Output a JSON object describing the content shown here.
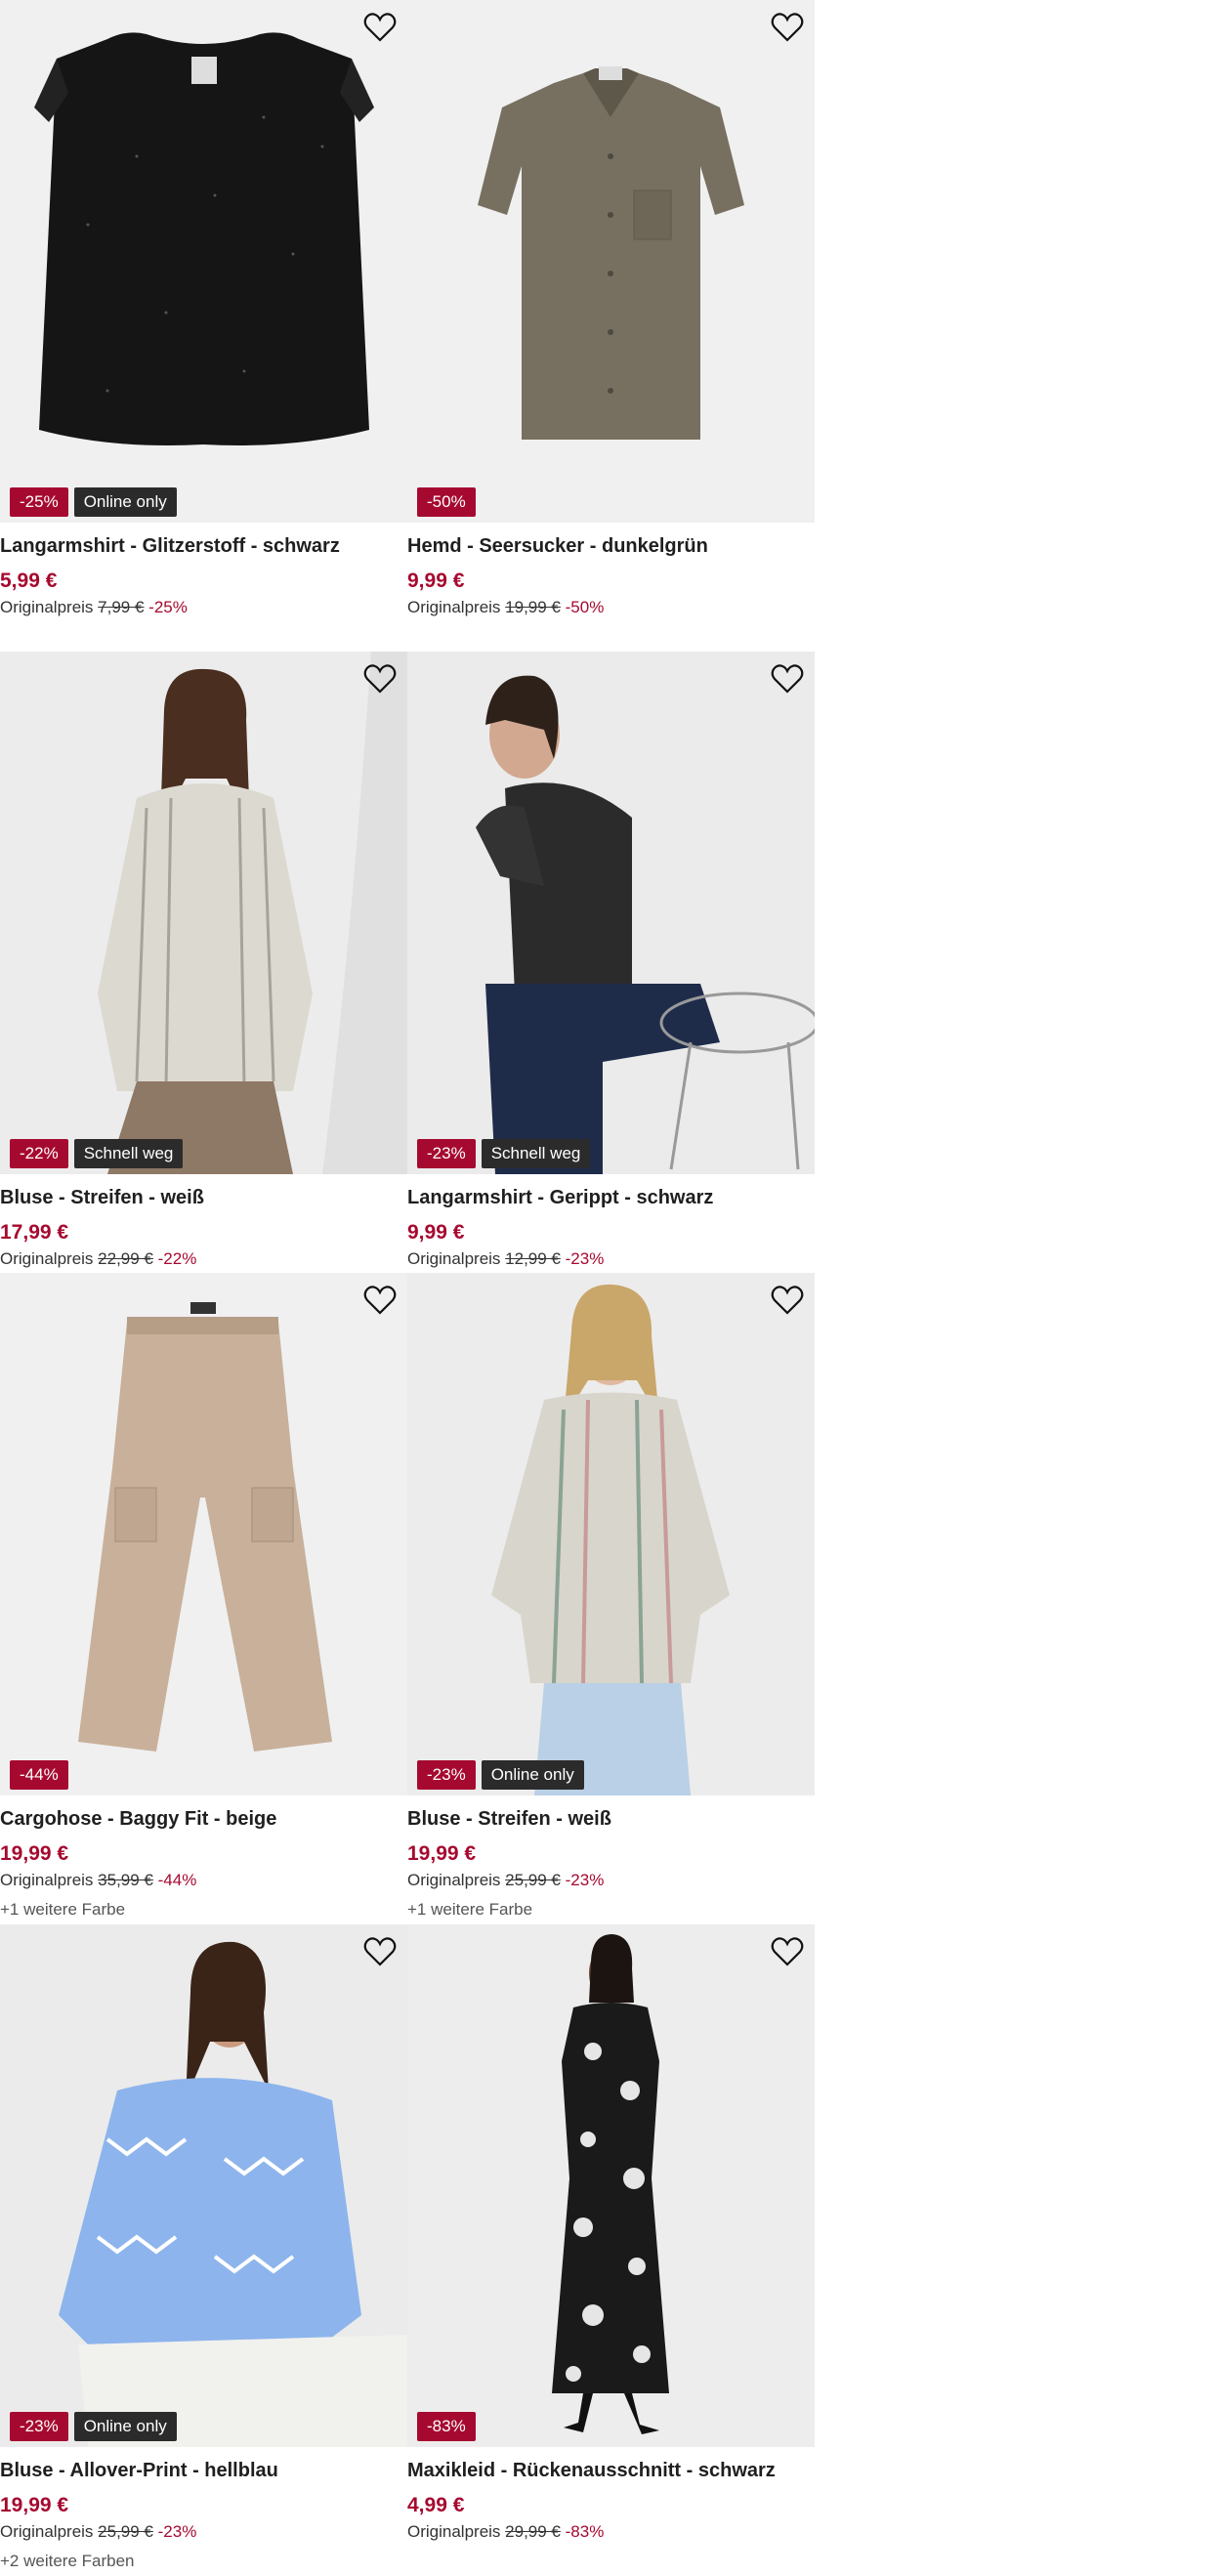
{
  "labels": {
    "original_price": "Originalpreis"
  },
  "colors": {
    "sale": "#a6092f",
    "dark_badge": "#2b2b2b",
    "image_bg": "#f0f0f0"
  },
  "products": [
    {
      "title": "Langarmshirt - Glitzerstoff - schwarz",
      "price": "5,99 €",
      "old_price": "7,99 €",
      "discount": "-25%",
      "badge_discount": "-25%",
      "badge_extra": "Online only",
      "more_colors": "",
      "image": "black-glitter-top"
    },
    {
      "title": "Hemd - Seersucker - dunkelgrün",
      "price": "9,99 €",
      "old_price": "19,99 €",
      "discount": "-50%",
      "badge_discount": "-50%",
      "badge_extra": "",
      "more_colors": "",
      "image": "green-shirt"
    },
    {
      "title": "Bluse - Streifen - weiß",
      "price": "17,99 €",
      "old_price": "22,99 €",
      "discount": "-22%",
      "badge_discount": "-22%",
      "badge_extra": "Schnell weg",
      "more_colors": "",
      "image": "model-striped-blouse"
    },
    {
      "title": "Langarmshirt - Gerippt - schwarz",
      "price": "9,99 €",
      "old_price": "12,99 €",
      "discount": "-23%",
      "badge_discount": "-23%",
      "badge_extra": "Schnell weg",
      "more_colors": "",
      "image": "model-black-top"
    },
    {
      "title": "Cargohose - Baggy Fit - beige",
      "price": "19,99 €",
      "old_price": "35,99 €",
      "discount": "-44%",
      "badge_discount": "-44%",
      "badge_extra": "",
      "more_colors": "+1 weitere Farbe",
      "image": "beige-cargo-pants"
    },
    {
      "title": "Bluse - Streifen - weiß",
      "price": "19,99 €",
      "old_price": "25,99 €",
      "discount": "-23%",
      "badge_discount": "-23%",
      "badge_extra": "Online only",
      "more_colors": "+1 weitere Farbe",
      "image": "model-striped-tunic"
    },
    {
      "title": "Bluse - Allover-Print - hellblau",
      "price": "19,99 €",
      "old_price": "25,99 €",
      "discount": "-23%",
      "badge_discount": "-23%",
      "badge_extra": "Online only",
      "more_colors": "+2 weitere Farben",
      "image": "model-blue-print-blouse"
    },
    {
      "title": "Maxikleid - Rückenausschnitt - schwarz",
      "price": "4,99 €",
      "old_price": "29,99 €",
      "discount": "-83%",
      "badge_discount": "-83%",
      "badge_extra": "",
      "more_colors": "",
      "image": "model-black-maxi-dress"
    }
  ]
}
